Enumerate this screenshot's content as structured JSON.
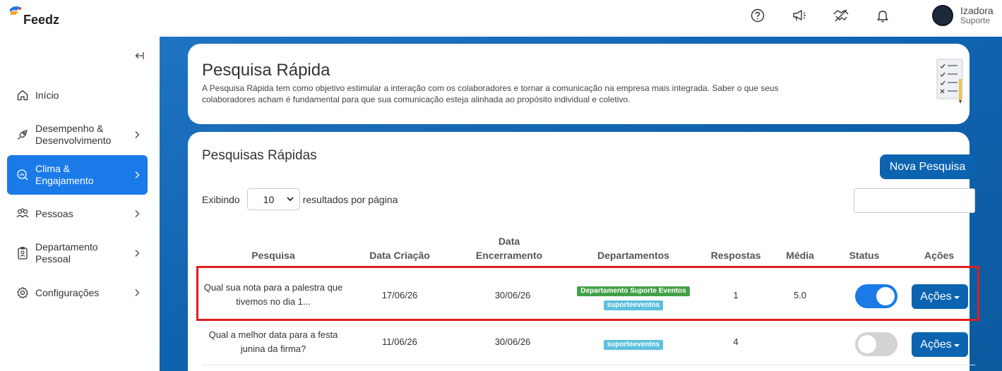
{
  "app": {
    "logo_text": "Feedz"
  },
  "user": {
    "name": "Izadora",
    "role": "Suporte"
  },
  "top_icons": [
    "help-icon",
    "megaphone-icon",
    "handshake-icon",
    "bell-icon"
  ],
  "sidebar": {
    "items": [
      {
        "label": "Início",
        "icon": "home-icon",
        "chevron": false,
        "active": false
      },
      {
        "label": "Desempenho & Desenvolvimento",
        "icon": "rocket-icon",
        "chevron": true,
        "active": false
      },
      {
        "label": "Clima & Engajamento",
        "icon": "chart-search-icon",
        "chevron": true,
        "active": true
      },
      {
        "label": "Pessoas",
        "icon": "people-icon",
        "chevron": true,
        "active": false
      },
      {
        "label": "Departamento Pessoal",
        "icon": "badge-icon",
        "chevron": true,
        "active": false
      },
      {
        "label": "Configurações",
        "icon": "gear-icon",
        "chevron": true,
        "active": false
      }
    ]
  },
  "header_card": {
    "title": "Pesquisa Rápida",
    "description": "A Pesquisa Rápida tem como objetivo estimular a interação com os colaboradores e tornar a comunicação na empresa mais integrada. Saber o que seus colaboradores acham é fundamental para que sua comunicação esteja alinhada ao propósito individual e coletivo."
  },
  "list": {
    "title": "Pesquisas Rápidas",
    "new_button": "Nova Pesquisa",
    "show_prefix": "Exibindo",
    "page_size": "10",
    "show_suffix": "resultados por página",
    "search_value": "",
    "columns": {
      "pesquisa": "Pesquisa",
      "data_criacao": "Data Criação",
      "data_encerramento": "Data Encerramento",
      "departamentos": "Departamentos",
      "respostas": "Respostas",
      "media": "Média",
      "status": "Status",
      "acoes": "Ações"
    },
    "rows": [
      {
        "pesquisa": "Qual sua nota para a palestra que tivemos no dia 1...",
        "data_criacao": "17/06/26",
        "data_encerramento": "30/06/26",
        "departamentos": [
          "Departamento Suporte Eventos",
          "suporteeventos"
        ],
        "respostas": "1",
        "media": "5.0",
        "status_on": true,
        "acoes": "Ações"
      },
      {
        "pesquisa": "Qual a melhor data para a festa junina da firma?",
        "data_criacao": "11/06/26",
        "data_encerramento": "30/06/26",
        "departamentos": [
          "suporteeventos"
        ],
        "respostas": "4",
        "media": "",
        "status_on": false,
        "acoes": "Ações"
      }
    ]
  },
  "colors": {
    "primary": "#0c64b0",
    "active_nav": "#1a7ae8",
    "highlight": "#e01e1e",
    "badge_green": "#43a047",
    "badge_cyan": "#5bc0de"
  }
}
